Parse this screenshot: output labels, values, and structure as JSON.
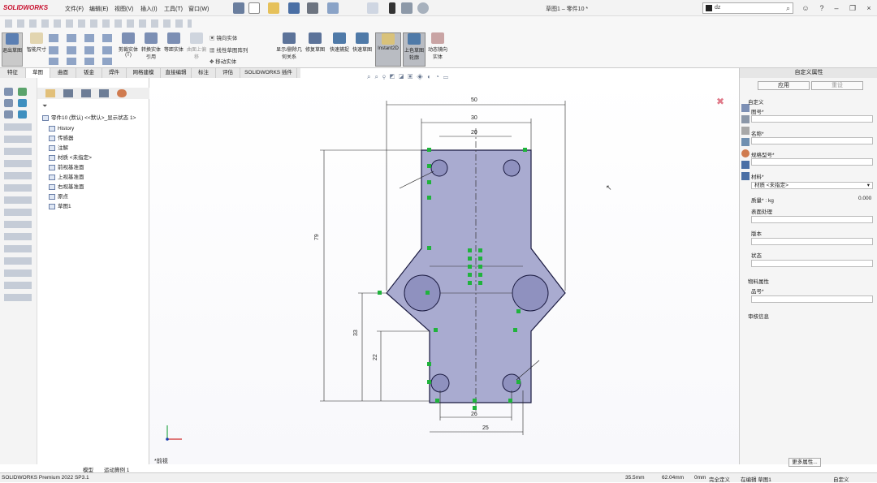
{
  "app": {
    "logo": "SOLIDWORKS",
    "doc_title": "草图1 – 零件10 *"
  },
  "menu": [
    "文件(F)",
    "编辑(E)",
    "视图(V)",
    "插入(I)",
    "工具(T)",
    "窗口(W)"
  ],
  "search": {
    "value": "dz"
  },
  "ribbon": {
    "buttons": [
      {
        "label": "退出草图"
      },
      {
        "label": "智能尺寸"
      },
      {
        "label": "剪裁实体(T)"
      },
      {
        "label": "转换实体引用"
      },
      {
        "label": "等距实体"
      },
      {
        "label": "曲面上偏移"
      },
      {
        "label": "显示/删除几何关系"
      },
      {
        "label": "修复草图"
      },
      {
        "label": "快速捕捉"
      },
      {
        "label": "快速草图"
      },
      {
        "label": "Instant2D"
      },
      {
        "label": "上色草图轮廓"
      },
      {
        "label": "动态镜向实体"
      }
    ],
    "small_items": [
      "镜向实体",
      "线性草图阵列",
      "移动实体"
    ]
  },
  "tabs": [
    "特征",
    "草图",
    "曲面",
    "钣金",
    "焊件",
    "网格建模",
    "直接编辑",
    "标注",
    "评估",
    "SOLIDWORKS 插件"
  ],
  "active_tab": "草图",
  "tree": {
    "root": "零件10 (默认) <<默认>_显示状态 1>",
    "items": [
      "History",
      "传感器",
      "注解",
      "材质 <未指定>",
      "前视基准面",
      "上视基准面",
      "右视基准面",
      "原点",
      "草图1"
    ]
  },
  "bottom_tabs": [
    "模型",
    "运动算例 1"
  ],
  "canvas": {
    "dimensions": [
      "50",
      "30",
      "20",
      "79",
      "33",
      "22",
      "26",
      "25"
    ],
    "view_label": "*前视"
  },
  "rpanel": {
    "title": "自定义属性",
    "apply_label": "应用",
    "reset_label": "重设",
    "section_custom": "自定义",
    "fields": [
      {
        "label": "图号*"
      },
      {
        "label": "名称*"
      },
      {
        "label": "规格型号*"
      },
      {
        "label": "材料*",
        "value": "材质 <未指定>"
      },
      {
        "label": "质量* : kg",
        "value": "0.000"
      },
      {
        "label": "表面处理"
      },
      {
        "label": "版本"
      },
      {
        "label": "状态"
      }
    ],
    "section_material": "物料属性",
    "material_fields": [
      {
        "label": "品号*"
      }
    ],
    "section_review": "审核信息",
    "more_label": "更多属性..."
  },
  "status": {
    "product": "SOLIDWORKS Premium 2022 SP3.1",
    "x": "35.5mm",
    "y": "62.04mm",
    "z": "0mm",
    "state": "完全定义",
    "editing": "在编辑 草图1",
    "custom": "自定义"
  },
  "colors": {
    "part_fill": "#a9abd0",
    "part_stroke": "#1a1a40",
    "accent": "#c8102e",
    "constraint": "#1fb33c"
  }
}
